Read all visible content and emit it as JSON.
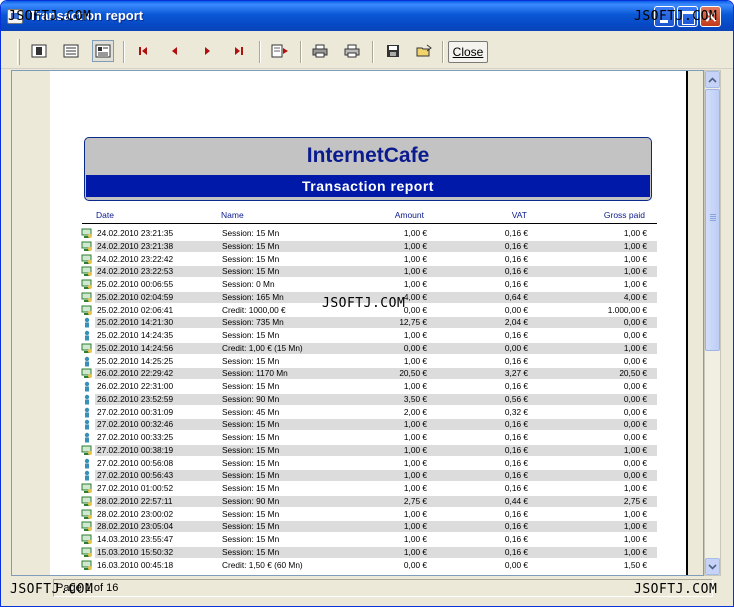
{
  "window": {
    "title": "Transaction report",
    "watermark": "JSOFTJ.COM",
    "colors": {
      "title_bar": "#0a58d6",
      "header_band": "#0019a8",
      "company_text": "#0a1a8f"
    }
  },
  "toolbar": {
    "close_label": "Close",
    "tools": [
      "single-page-icon",
      "multi-page-icon",
      "page-setup-icon",
      "first-page-icon",
      "prev-page-icon",
      "next-page-icon",
      "last-page-icon",
      "goto-page-icon",
      "printer-settings-icon",
      "print-icon",
      "save-icon",
      "open-icon"
    ]
  },
  "report": {
    "company": "InternetCafe",
    "title": "Transaction report",
    "columns": {
      "date": "Date",
      "name": "Name",
      "amount": "Amount",
      "vat": "VAT",
      "gross": "Gross paid"
    },
    "rows": [
      {
        "icon": "pc-icon",
        "date": "24.02.2010 23:21:35",
        "name": "Session: 15 Mn",
        "amount": "1,00 €",
        "vat": "0,16 €",
        "gross": "1,00 €"
      },
      {
        "icon": "pc-icon",
        "date": "24.02.2010 23:21:38",
        "name": "Session: 15 Mn",
        "amount": "1,00 €",
        "vat": "0,16 €",
        "gross": "1,00 €"
      },
      {
        "icon": "pc-icon",
        "date": "24.02.2010 23:22:42",
        "name": "Session: 15 Mn",
        "amount": "1,00 €",
        "vat": "0,16 €",
        "gross": "1,00 €"
      },
      {
        "icon": "pc-icon",
        "date": "24.02.2010 23:22:53",
        "name": "Session: 15 Mn",
        "amount": "1,00 €",
        "vat": "0,16 €",
        "gross": "1,00 €"
      },
      {
        "icon": "pc-icon",
        "date": "25.02.2010 00:06:55",
        "name": "Session: 0 Mn",
        "amount": "1,00 €",
        "vat": "0,16 €",
        "gross": "1,00 €"
      },
      {
        "icon": "pc-icon",
        "date": "25.02.2010 02:04:59",
        "name": "Session: 165 Mn",
        "amount": "4,00 €",
        "vat": "0,64 €",
        "gross": "4,00 €"
      },
      {
        "icon": "pc-icon",
        "date": "25.02.2010 02:06:41",
        "name": "Credit: 1000,00 €",
        "amount": "0,00 €",
        "vat": "0,00 €",
        "gross": "1.000,00 €"
      },
      {
        "icon": "user-icon",
        "date": "25.02.2010 14:21:30",
        "name": "Session: 735 Mn",
        "amount": "12,75 €",
        "vat": "2,04 €",
        "gross": "0,00 €"
      },
      {
        "icon": "user-icon",
        "date": "25.02.2010 14:24:35",
        "name": "Session: 15 Mn",
        "amount": "1,00 €",
        "vat": "0,16 €",
        "gross": "0,00 €"
      },
      {
        "icon": "pc-icon",
        "date": "25.02.2010 14:24:56",
        "name": "Credit: 1,00 € (15 Mn)",
        "amount": "0,00 €",
        "vat": "0,00 €",
        "gross": "1,00 €"
      },
      {
        "icon": "user-icon",
        "date": "25.02.2010 14:25:25",
        "name": "Session: 15 Mn",
        "amount": "1,00 €",
        "vat": "0,16 €",
        "gross": "0,00 €"
      },
      {
        "icon": "pc-icon",
        "date": "26.02.2010 22:29:42",
        "name": "Session: 1170 Mn",
        "amount": "20,50 €",
        "vat": "3,27 €",
        "gross": "20,50 €"
      },
      {
        "icon": "user-icon",
        "date": "26.02.2010 22:31:00",
        "name": "Session: 15 Mn",
        "amount": "1,00 €",
        "vat": "0,16 €",
        "gross": "0,00 €"
      },
      {
        "icon": "user-icon",
        "date": "26.02.2010 23:52:59",
        "name": "Session: 90 Mn",
        "amount": "3,50 €",
        "vat": "0,56 €",
        "gross": "0,00 €"
      },
      {
        "icon": "user-icon",
        "date": "27.02.2010 00:31:09",
        "name": "Session: 45 Mn",
        "amount": "2,00 €",
        "vat": "0,32 €",
        "gross": "0,00 €"
      },
      {
        "icon": "user-icon",
        "date": "27.02.2010 00:32:46",
        "name": "Session: 15 Mn",
        "amount": "1,00 €",
        "vat": "0,16 €",
        "gross": "0,00 €"
      },
      {
        "icon": "user-icon",
        "date": "27.02.2010 00:33:25",
        "name": "Session: 15 Mn",
        "amount": "1,00 €",
        "vat": "0,16 €",
        "gross": "0,00 €"
      },
      {
        "icon": "pc-icon",
        "date": "27.02.2010 00:38:19",
        "name": "Session: 15 Mn",
        "amount": "1,00 €",
        "vat": "0,16 €",
        "gross": "1,00 €"
      },
      {
        "icon": "user-icon",
        "date": "27.02.2010 00:56:08",
        "name": "Session: 15 Mn",
        "amount": "1,00 €",
        "vat": "0,16 €",
        "gross": "0,00 €"
      },
      {
        "icon": "user-icon",
        "date": "27.02.2010 00:56:43",
        "name": "Session: 15 Mn",
        "amount": "1,00 €",
        "vat": "0,16 €",
        "gross": "0,00 €"
      },
      {
        "icon": "pc-icon",
        "date": "27.02.2010 01:00:52",
        "name": "Session: 15 Mn",
        "amount": "1,00 €",
        "vat": "0,16 €",
        "gross": "1,00 €"
      },
      {
        "icon": "pc-icon",
        "date": "28.02.2010 22:57:11",
        "name": "Session: 90 Mn",
        "amount": "2,75 €",
        "vat": "0,44 €",
        "gross": "2,75 €"
      },
      {
        "icon": "pc-icon",
        "date": "28.02.2010 23:00:02",
        "name": "Session: 15 Mn",
        "amount": "1,00 €",
        "vat": "0,16 €",
        "gross": "1,00 €"
      },
      {
        "icon": "pc-icon",
        "date": "28.02.2010 23:05:04",
        "name": "Session: 15 Mn",
        "amount": "1,00 €",
        "vat": "0,16 €",
        "gross": "1,00 €"
      },
      {
        "icon": "pc-icon",
        "date": "14.03.2010 23:55:47",
        "name": "Session: 15 Mn",
        "amount": "1,00 €",
        "vat": "0,16 €",
        "gross": "1,00 €"
      },
      {
        "icon": "pc-icon",
        "date": "15.03.2010 15:50:32",
        "name": "Session: 15 Mn",
        "amount": "1,00 €",
        "vat": "0,16 €",
        "gross": "1,00 €"
      },
      {
        "icon": "pc-icon",
        "date": "16.03.2010 00:45:18",
        "name": "Credit: 1,50 € (60 Mn)",
        "amount": "0,00 €",
        "vat": "0,00 €",
        "gross": "1,50 €"
      }
    ]
  },
  "status": {
    "page_info": "Page 1 of 16"
  }
}
